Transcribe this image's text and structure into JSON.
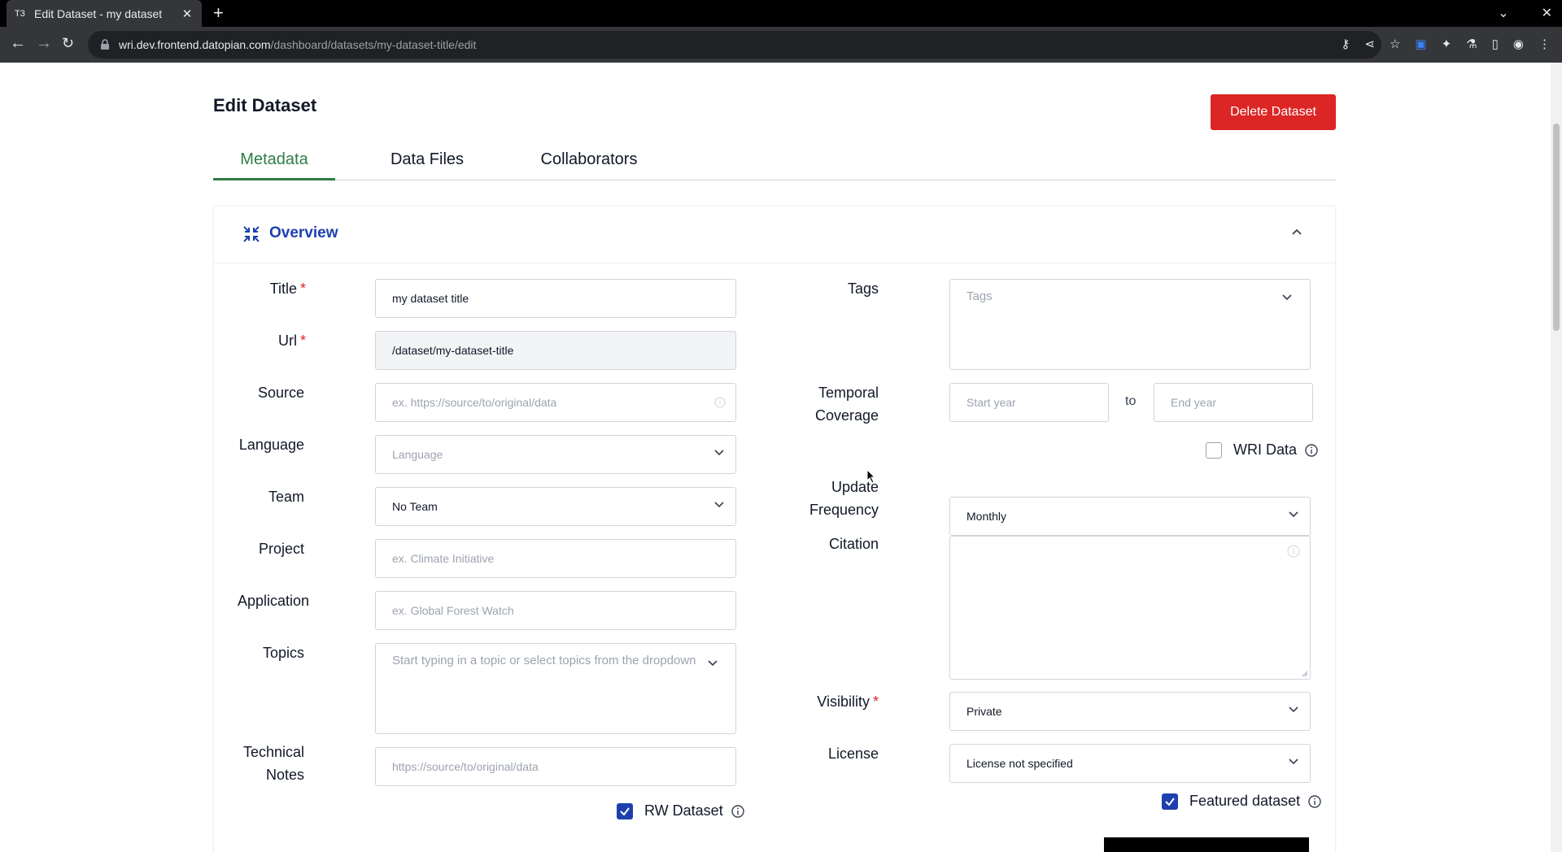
{
  "browser": {
    "tab_title": "Edit Dataset - my dataset",
    "favicon": "T3",
    "url_host": "wri.dev.frontend.datopian.com",
    "url_path": "/dashboard/datasets/my-dataset-title/edit"
  },
  "page": {
    "title": "Edit Dataset",
    "delete_label": "Delete Dataset"
  },
  "tabs": [
    {
      "label": "Metadata",
      "active": true
    },
    {
      "label": "Data Files",
      "active": false
    },
    {
      "label": "Collaborators",
      "active": false
    }
  ],
  "overview": {
    "title": "Overview"
  },
  "left": {
    "title_label": "Title",
    "title_value": "my dataset title",
    "url_label": "Url",
    "url_value": "/dataset/my-dataset-title",
    "source_label": "Source",
    "source_placeholder": "ex. https://source/to/original/data",
    "language_label": "Language",
    "language_placeholder": "Language",
    "team_label": "Team",
    "team_value": "No Team",
    "project_label": "Project",
    "project_placeholder": "ex. Climate Initiative",
    "application_label": "Application",
    "application_placeholder": "ex. Global Forest Watch",
    "topics_label": "Topics",
    "topics_placeholder": "Start typing in a topic or select topics from the dropdown",
    "technical_label_1": "Technical",
    "technical_label_2": "Notes",
    "technical_placeholder": "https://source/to/original/data",
    "rw_label": "RW Dataset"
  },
  "right": {
    "tags_label": "Tags",
    "tags_placeholder": "Tags",
    "temporal_label_1": "Temporal",
    "temporal_label_2": "Coverage",
    "start_placeholder": "Start year",
    "to_text": "to",
    "end_placeholder": "End year",
    "wri_label": "WRI Data",
    "update_label_1": "Update",
    "update_label_2": "Frequency",
    "update_value": "Monthly",
    "citation_label": "Citation",
    "visibility_label": "Visibility",
    "visibility_value": "Private",
    "license_label": "License",
    "license_value": "License not specified",
    "featured_label": "Featured dataset"
  },
  "colors": {
    "accent_green": "#2f7d46",
    "accent_blue": "#1e40af",
    "danger": "#dc2626"
  }
}
